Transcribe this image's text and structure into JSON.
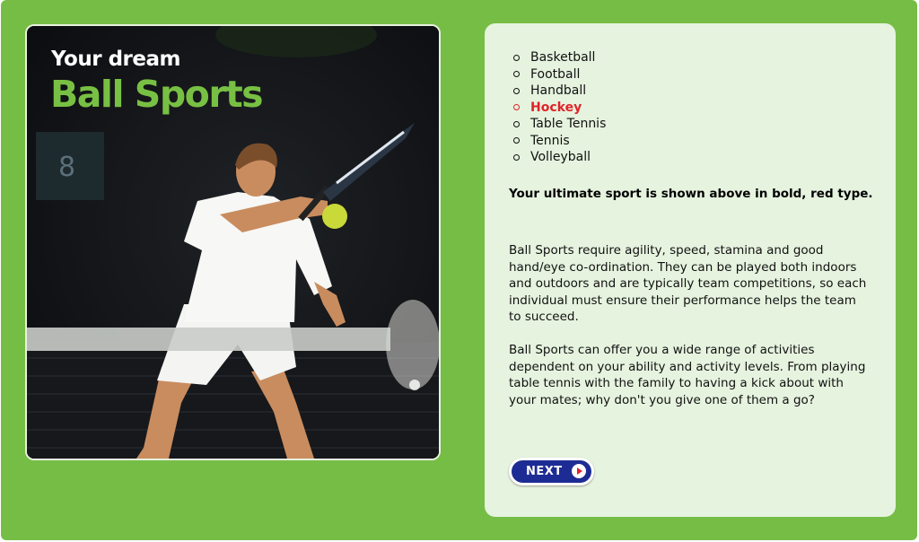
{
  "hero": {
    "kicker": "Your dream",
    "title": "Ball Sports",
    "court_number": "8"
  },
  "sports": [
    {
      "label": "Basketball",
      "selected": false
    },
    {
      "label": "Football",
      "selected": false
    },
    {
      "label": "Handball",
      "selected": false
    },
    {
      "label": "Hockey",
      "selected": true
    },
    {
      "label": "Table Tennis",
      "selected": false
    },
    {
      "label": "Tennis",
      "selected": false
    },
    {
      "label": "Volleyball",
      "selected": false
    }
  ],
  "result": {
    "lead": "Your ultimate sport is shown above in bold, red type.",
    "paragraph_1": "Ball Sports require agility, speed, stamina and good hand/eye co-ordination. They can be played both indoors and outdoors and are typically team competitions, so each individual must ensure their performance helps the team to succeed.",
    "paragraph_2": "Ball Sports can offer you a wide range of activities dependent on your ability and activity levels. From playing table tennis with the family to having a kick about with your mates; why don't you give one of them a go?"
  },
  "navigation": {
    "next_label": "NEXT"
  },
  "colors": {
    "background_green": "#76bd46",
    "panel": "#e6f3df",
    "title_green": "#78c043",
    "highlight_red": "#e0232a",
    "button_blue": "#1d2c94"
  },
  "icons": {
    "next": "play-arrow-icon",
    "bullet": "circle-bullet-icon"
  }
}
